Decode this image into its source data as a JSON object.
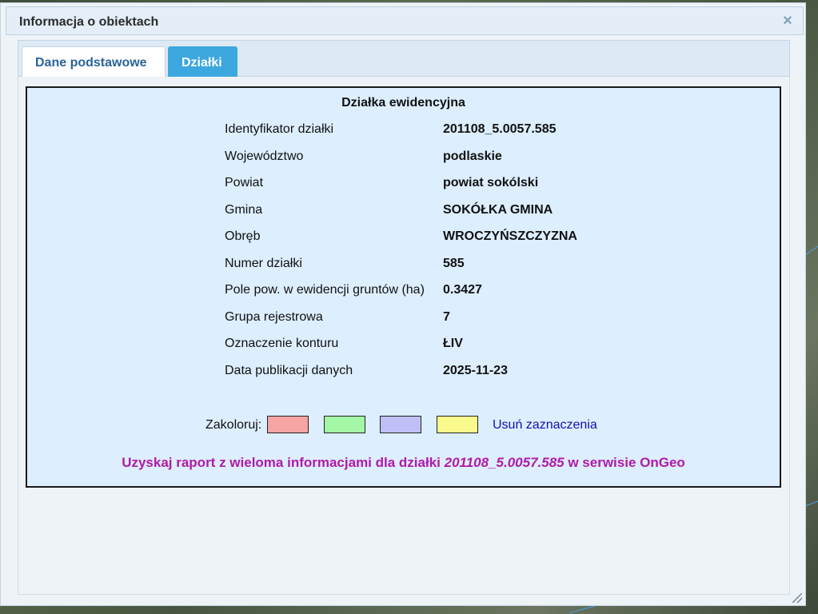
{
  "dialog": {
    "title": "Informacja o obiektach",
    "close_symbol": "×"
  },
  "tabs": [
    {
      "label": "Dane podstawowe",
      "active": true
    },
    {
      "label": "Działki",
      "active": false
    }
  ],
  "parcel": {
    "heading": "Działka ewidencyjna",
    "rows": [
      {
        "label": "Identyfikator działki",
        "value": "201108_5.0057.585"
      },
      {
        "label": "Województwo",
        "value": "podlaskie"
      },
      {
        "label": "Powiat",
        "value": "powiat sokólski"
      },
      {
        "label": "Gmina",
        "value": "SOKÓŁKA GMINA"
      },
      {
        "label": "Obręb",
        "value": "WROCZYŃSZCZYZNA"
      },
      {
        "label": "Numer działki",
        "value": "585"
      },
      {
        "label": "Pole pow. w ewidencji gruntów (ha)",
        "value": "0.3427"
      },
      {
        "label": "Grupa rejestrowa",
        "value": "7"
      },
      {
        "label": "Oznaczenie konturu",
        "value": "ŁIV"
      },
      {
        "label": "Data publikacji danych",
        "value": "2025-11-23"
      }
    ]
  },
  "colorize": {
    "label": "Zakoloruj:",
    "swatches": [
      "#f7a4a4",
      "#a4f7a4",
      "#c0c0f7",
      "#fafa8c"
    ],
    "clear_label": "Usuń zaznaczenia"
  },
  "report": {
    "prefix": "Uzyskaj raport z wieloma informacjami dla działki ",
    "parcel_id": "201108_5.0057.585",
    "suffix": " w serwisie OnGeo"
  },
  "colors": {
    "accent_tab": "#3da7df",
    "report_link": "#b01aa8",
    "clear_link": "#1a0dab"
  }
}
